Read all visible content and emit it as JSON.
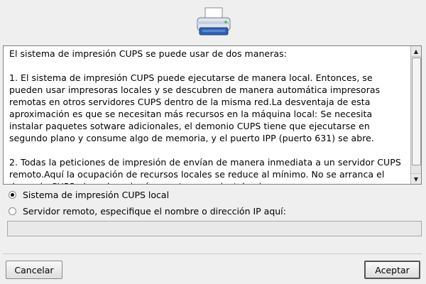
{
  "header": {
    "icon": "printer-icon"
  },
  "info_text": "El sistema de impresión CUPS se puede usar de dos maneras:\n\n1. El sistema de impresión CUPS puede ejecutarse de manera local. Entonces, se pueden usar impresoras locales y se descubren de manera automática impresoras remotas en otros servidores CUPS dentro de la misma red.La desventaja de esta aproximación es que se necesitan más recursos en la máquina local: Se necesita instalar paquetes sotware adicionales, el demonio CUPS tiene que ejecutarse en segundo plano y consume algo de memoria, y el puerto IPP (puerto 631) se abre.\n\n2. Todas la peticiones de impresión de envían de manera inmediata a un servidor CUPS remoto.Aquí la ocupación de recursos locales se reduce al mínimo. No se arranca el demonio CUPS ni se abre ningún puerto, no se instala ninguna",
  "options": [
    {
      "label": "Sistema de impresión CUPS local",
      "selected": true
    },
    {
      "label": "Servidor remoto, especifique el nombre o dirección IP aquí:",
      "selected": false
    }
  ],
  "server_field": {
    "value": "",
    "placeholder": ""
  },
  "buttons": {
    "cancel": "Cancelar",
    "ok": "Aceptar"
  },
  "colors": {
    "background": "#efefef",
    "panel": "#ffffff",
    "border": "#7f7f7f",
    "printer_body": "#dfe4ec",
    "printer_blue": "#2f63b2"
  }
}
